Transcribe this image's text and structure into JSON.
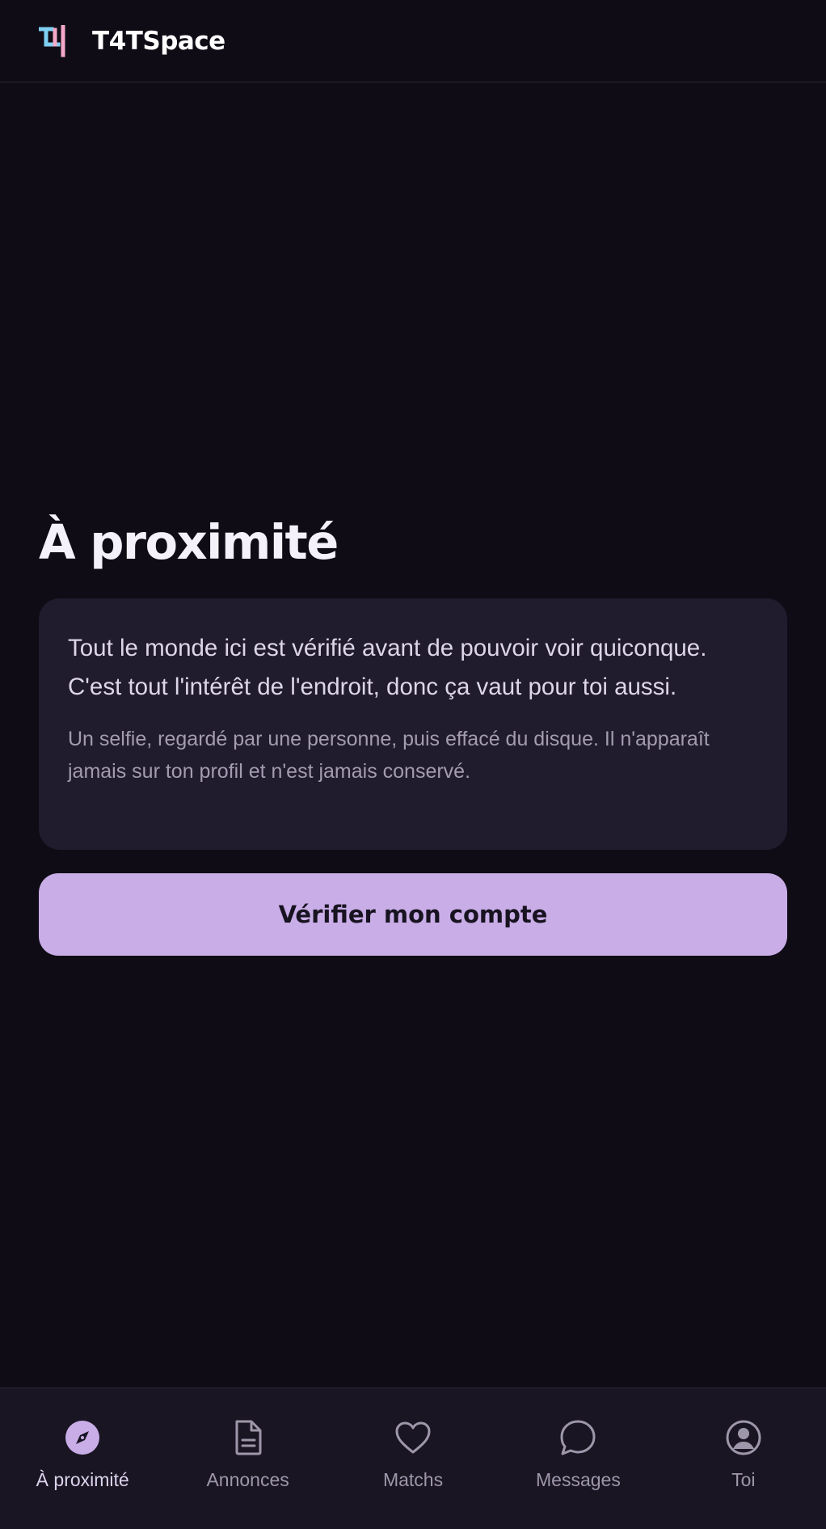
{
  "app": {
    "brand": "T4TSpace"
  },
  "main": {
    "title": "À proximité",
    "card": {
      "lead": "Tout le monde ici est vérifié avant de pouvoir voir quiconque. C'est tout l'intérêt de l'endroit, donc ça vaut pour toi aussi.",
      "sub": "Un selfie, regardé par une personne, puis effacé du disque. Il n'apparaît jamais sur ton profil et n'est jamais conservé."
    },
    "cta_label": "Vérifier mon compte"
  },
  "nav": {
    "items": [
      {
        "label": "À proximité",
        "icon": "compass-icon",
        "active": true
      },
      {
        "label": "Annonces",
        "icon": "document-icon",
        "active": false
      },
      {
        "label": "Matchs",
        "icon": "heart-icon",
        "active": false
      },
      {
        "label": "Messages",
        "icon": "chat-bubble-icon",
        "active": false
      },
      {
        "label": "Toi",
        "icon": "user-circle-icon",
        "active": false
      }
    ]
  },
  "colors": {
    "background": "#0f0c16",
    "card": "#211b2e",
    "accent": "#c9ade7",
    "nav_bg": "#191523",
    "logo_blue": "#7fd0f2",
    "logo_pink": "#f3a9c7"
  }
}
